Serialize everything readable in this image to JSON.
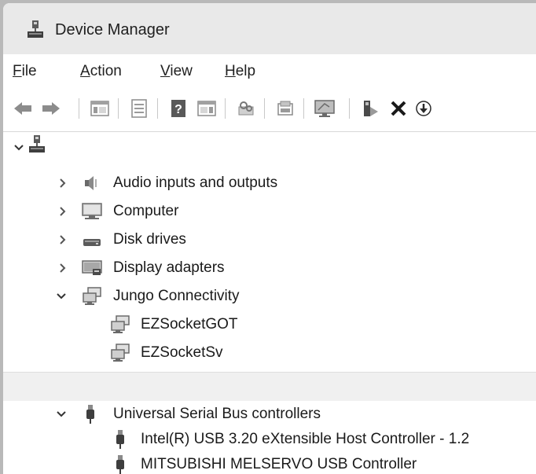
{
  "window": {
    "title": "Device Manager"
  },
  "menu": [
    {
      "key": "file",
      "accel": "F",
      "rest": "ile"
    },
    {
      "key": "action",
      "accel": "A",
      "rest": "ction"
    },
    {
      "key": "view",
      "accel": "V",
      "rest": "iew"
    },
    {
      "key": "help",
      "accel": "H",
      "rest": "elp"
    }
  ],
  "toolbar": {
    "buttons": [
      "back-icon",
      "forward-icon",
      "show-hide-console-tree-icon",
      "properties-icon",
      "help-icon",
      "action-pane-icon",
      "update-driver-icon",
      "scan-hardware-icon",
      "display-icon",
      "enable-device-icon",
      "uninstall-device-icon",
      "download-icon"
    ]
  },
  "tree": {
    "root_icon": "computer-root-icon",
    "categories": [
      {
        "label": "Audio inputs and outputs",
        "icon": "speaker-icon",
        "expanded": false
      },
      {
        "label": "Computer",
        "icon": "monitor-icon",
        "expanded": false
      },
      {
        "label": "Disk drives",
        "icon": "disk-drive-icon",
        "expanded": false
      },
      {
        "label": "Display adapters",
        "icon": "display-adapter-icon",
        "expanded": false
      },
      {
        "label": "Jungo Connectivity",
        "icon": "network-icon",
        "expanded": true,
        "children": [
          {
            "label": "EZSocketGOT"
          },
          {
            "label": "EZSocketSv"
          }
        ]
      }
    ],
    "usb": {
      "label": "Universal Serial Bus controllers",
      "expanded": true,
      "children": [
        {
          "label": "Intel(R) USB 3.20 eXtensible Host Controller - 1.2"
        },
        {
          "label": "MITSUBISHI MELSERVO USB Controller"
        }
      ]
    }
  }
}
